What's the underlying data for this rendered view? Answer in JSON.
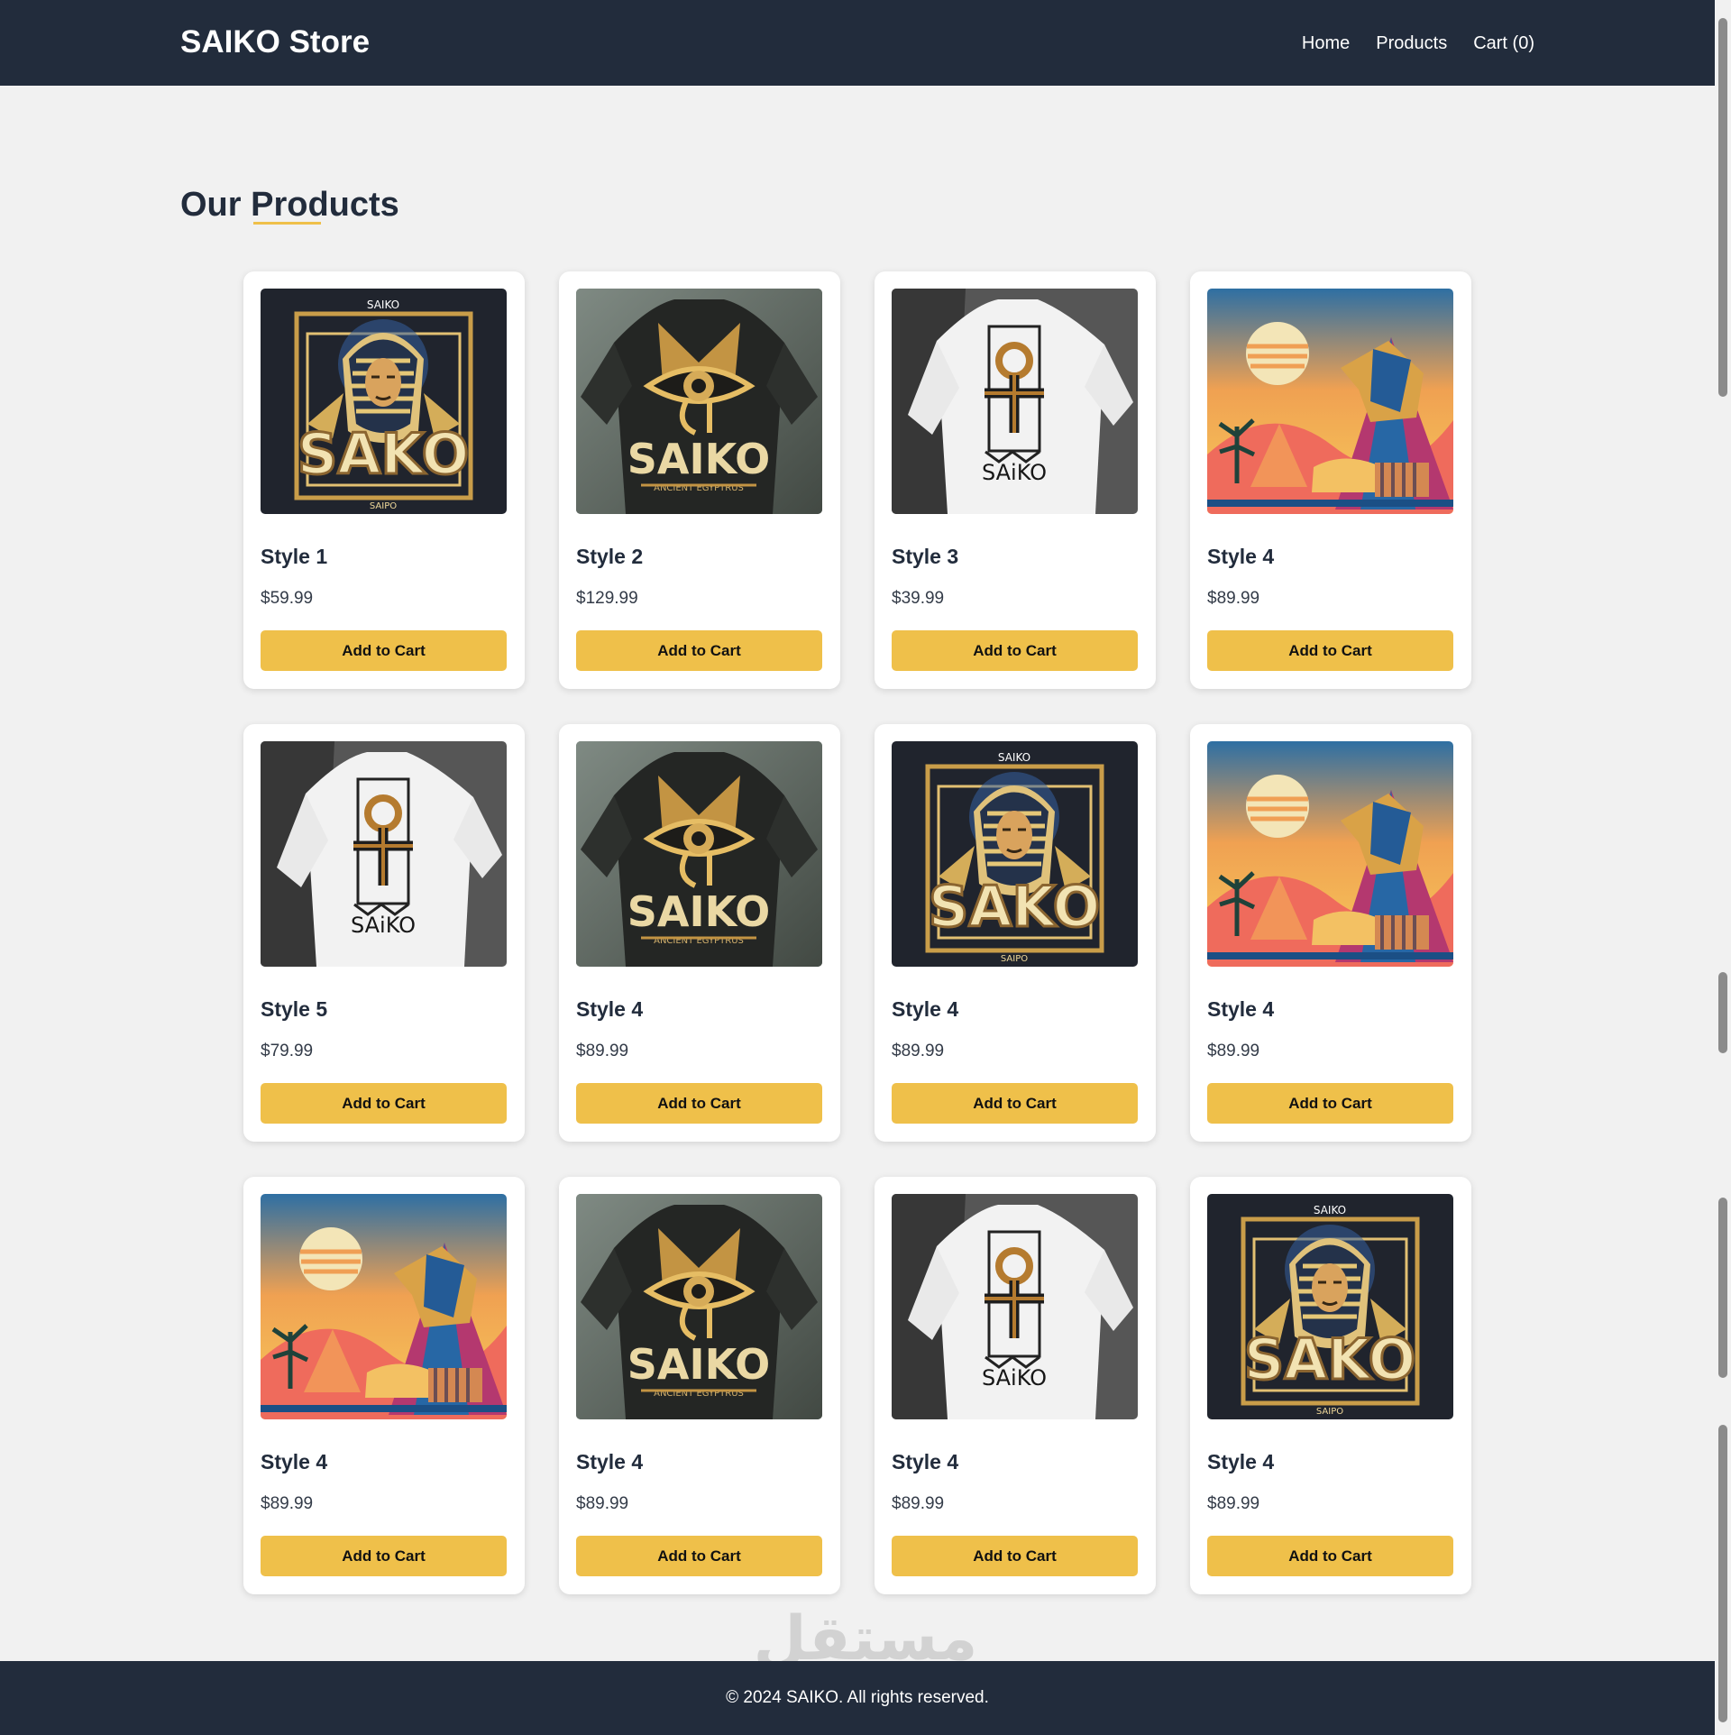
{
  "site": {
    "brand": "SAIKO Store",
    "nav": [
      {
        "label": "Home"
      },
      {
        "label": "Products"
      },
      {
        "label": "Cart (0)"
      }
    ]
  },
  "main": {
    "section_title": "Our Products",
    "products": [
      {
        "name": "Style 1",
        "price": "$59.99",
        "button_label": "Add to Cart",
        "art": "pharaoh"
      },
      {
        "name": "Style 2",
        "price": "$129.99",
        "button_label": "Add to Cart",
        "art": "dark-tee"
      },
      {
        "name": "Style 3",
        "price": "$39.99",
        "button_label": "Add to Cart",
        "art": "white-tee"
      },
      {
        "name": "Style 4",
        "price": "$89.99",
        "button_label": "Add to Cart",
        "art": "sphinx"
      },
      {
        "name": "Style 5",
        "price": "$79.99",
        "button_label": "Add to Cart",
        "art": "white-tee"
      },
      {
        "name": "Style 4",
        "price": "$89.99",
        "button_label": "Add to Cart",
        "art": "dark-tee"
      },
      {
        "name": "Style 4",
        "price": "$89.99",
        "button_label": "Add to Cart",
        "art": "pharaoh"
      },
      {
        "name": "Style 4",
        "price": "$89.99",
        "button_label": "Add to Cart",
        "art": "sphinx"
      },
      {
        "name": "Style 4",
        "price": "$89.99",
        "button_label": "Add to Cart",
        "art": "sphinx"
      },
      {
        "name": "Style 4",
        "price": "$89.99",
        "button_label": "Add to Cart",
        "art": "dark-tee"
      },
      {
        "name": "Style 4",
        "price": "$89.99",
        "button_label": "Add to Cart",
        "art": "white-tee"
      },
      {
        "name": "Style 4",
        "price": "$89.99",
        "button_label": "Add to Cart",
        "art": "pharaoh"
      }
    ]
  },
  "footer": {
    "copyright": "© 2024 SAIKO. All rights reserved."
  },
  "overlay": {
    "watermark_text": "مستقل",
    "watermark_url": "mostaql.com"
  },
  "colors": {
    "nav_background": "#222c3c",
    "page_background": "#f1f1f1",
    "card_background": "#ffffff",
    "accent": "#efc04a",
    "heading": "#222c3c",
    "footer_background": "#222c3c"
  },
  "icons": {
    "product_art": [
      "pharaoh",
      "dark-tee",
      "white-tee",
      "sphinx"
    ]
  }
}
